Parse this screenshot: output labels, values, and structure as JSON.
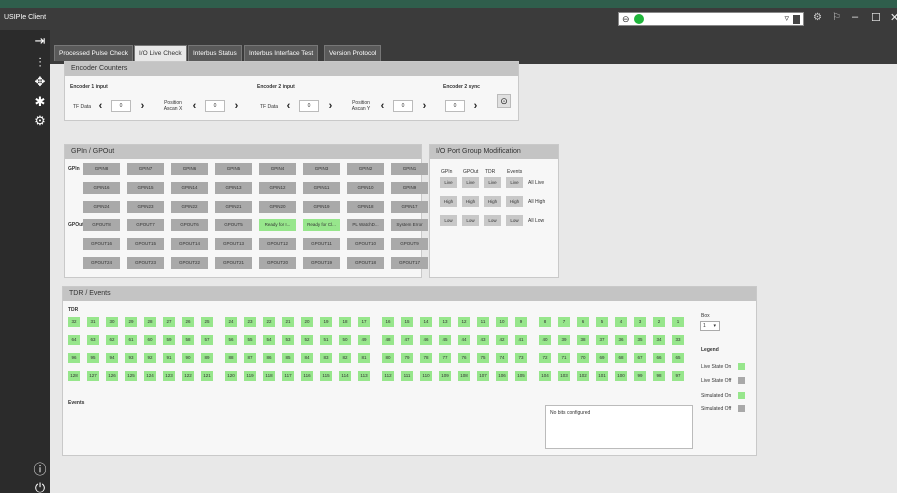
{
  "window": {
    "title": "USIPIe Client"
  },
  "sidebar": {
    "top_icons": [
      "sign-in-icon",
      "equalizer-icon",
      "arrows-move-icon",
      "bug-icon",
      "gear-icon"
    ],
    "bottom_icons": [
      "info-icon",
      "power-icon"
    ]
  },
  "tabs": [
    {
      "label": "Processed Pulse Check"
    },
    {
      "label": "I/O Live Check"
    },
    {
      "label": "Interbus Status"
    },
    {
      "label": "Interbus Interface Test"
    },
    {
      "label": "Version Protocol"
    }
  ],
  "active_tab": "I/O Live Check",
  "encoder": {
    "title": "Encoder Counters",
    "enc1": {
      "label": "Encoder 1 input",
      "tf_label": "TF Data",
      "tf_value": "0",
      "pos_label": "Position Ascan X",
      "pos_value": "0"
    },
    "enc2": {
      "label": "Encoder 2 input",
      "tf_label": "TF Data",
      "tf_value": "0",
      "pos_label": "Position Ascan Y",
      "pos_value": "0"
    },
    "sync": {
      "label": "Encoder 2 sync",
      "value": "0"
    }
  },
  "gpio": {
    "title": "GPIn / GPOut",
    "gpin_label": "GPIn",
    "gpout_label": "GPOut",
    "gpin_rows": [
      [
        {
          "t": "GPIN8"
        },
        {
          "t": "GPIN7"
        },
        {
          "t": "GPIN6"
        },
        {
          "t": "GPIN5"
        },
        {
          "t": "GPIN4"
        },
        {
          "t": "GPIN3"
        },
        {
          "t": "GPIN2"
        },
        {
          "t": "GPIN1"
        }
      ],
      [
        {
          "t": "GPIN16"
        },
        {
          "t": "GPIN15"
        },
        {
          "t": "GPIN14"
        },
        {
          "t": "GPIN13"
        },
        {
          "t": "GPIN12"
        },
        {
          "t": "GPIN11"
        },
        {
          "t": "GPIN10"
        },
        {
          "t": "GPIN9"
        }
      ],
      [
        {
          "t": "GPIN24"
        },
        {
          "t": "GPIN23"
        },
        {
          "t": "GPIN22"
        },
        {
          "t": "GPIN21"
        },
        {
          "t": "GPIN20"
        },
        {
          "t": "GPIN19"
        },
        {
          "t": "GPIN18"
        },
        {
          "t": "GPIN17"
        }
      ]
    ],
    "gpout_rows": [
      [
        {
          "t": "GPOUT8"
        },
        {
          "t": "GPOUT7"
        },
        {
          "t": "GPOUT6"
        },
        {
          "t": "GPOUT5"
        },
        {
          "t": "Ready for I...",
          "on": true
        },
        {
          "t": "Ready for Cl...",
          "on": true
        },
        {
          "t": "PL WatchD..."
        },
        {
          "t": "System Error"
        }
      ],
      [
        {
          "t": "GPOUT16"
        },
        {
          "t": "GPOUT15"
        },
        {
          "t": "GPOUT14"
        },
        {
          "t": "GPOUT13"
        },
        {
          "t": "GPOUT12"
        },
        {
          "t": "GPOUT11"
        },
        {
          "t": "GPOUT10"
        },
        {
          "t": "GPOUT9"
        }
      ],
      [
        {
          "t": "GPOUT24"
        },
        {
          "t": "GPOUT23"
        },
        {
          "t": "GPOUT22"
        },
        {
          "t": "GPOUT21"
        },
        {
          "t": "GPOUT20"
        },
        {
          "t": "GPOUT19"
        },
        {
          "t": "GPOUT18"
        },
        {
          "t": "GPOUT17"
        }
      ]
    ]
  },
  "portmod": {
    "title": "I/O Port Group Modification",
    "headers": [
      "GPIn",
      "GPOut",
      "TDR",
      "Events"
    ],
    "rows": [
      {
        "button": "Live",
        "all": "All Live"
      },
      {
        "button": "High",
        "all": "All High"
      },
      {
        "button": "Low",
        "all": "All Low"
      }
    ]
  },
  "tdr": {
    "title": "TDR / Events",
    "tdr_label": "TDR",
    "events_label": "Events",
    "rows": [
      [
        "32",
        "31",
        "30",
        "29",
        "28",
        "27",
        "26",
        "25",
        "24",
        "23",
        "22",
        "21",
        "20",
        "19",
        "18",
        "17",
        "16",
        "15",
        "14",
        "13",
        "12",
        "11",
        "10",
        "9",
        "8",
        "7",
        "6",
        "5",
        "4",
        "3",
        "2",
        "1"
      ],
      [
        "64",
        "63",
        "62",
        "61",
        "60",
        "59",
        "58",
        "57",
        "56",
        "55",
        "54",
        "53",
        "52",
        "51",
        "50",
        "49",
        "48",
        "47",
        "46",
        "45",
        "44",
        "43",
        "42",
        "41",
        "40",
        "39",
        "38",
        "37",
        "36",
        "35",
        "34",
        "33"
      ],
      [
        "96",
        "95",
        "94",
        "93",
        "92",
        "91",
        "90",
        "89",
        "88",
        "87",
        "86",
        "85",
        "84",
        "83",
        "82",
        "81",
        "80",
        "79",
        "78",
        "77",
        "76",
        "75",
        "74",
        "73",
        "72",
        "71",
        "70",
        "69",
        "68",
        "67",
        "66",
        "65"
      ],
      [
        "128",
        "127",
        "126",
        "125",
        "124",
        "123",
        "122",
        "121",
        "120",
        "119",
        "118",
        "117",
        "116",
        "115",
        "114",
        "113",
        "112",
        "111",
        "110",
        "109",
        "108",
        "107",
        "106",
        "105",
        "104",
        "103",
        "102",
        "101",
        "100",
        "99",
        "98",
        "97"
      ]
    ],
    "box_label": "Box",
    "box_value": "1",
    "no_bits": "No bits configured",
    "legend": {
      "title": "Legend",
      "items": [
        {
          "label": "Live State On",
          "color": "#97e68c"
        },
        {
          "label": "Live State Off",
          "color": "#a9a9a9"
        },
        {
          "label": "Simulated On",
          "color": "#97e68c"
        },
        {
          "label": "Simulated Off",
          "color": "#a9a9a9"
        }
      ]
    }
  },
  "colors": {
    "on": "#97e68c",
    "off": "#a9a9a9",
    "status_ok": "#1fb53b"
  }
}
